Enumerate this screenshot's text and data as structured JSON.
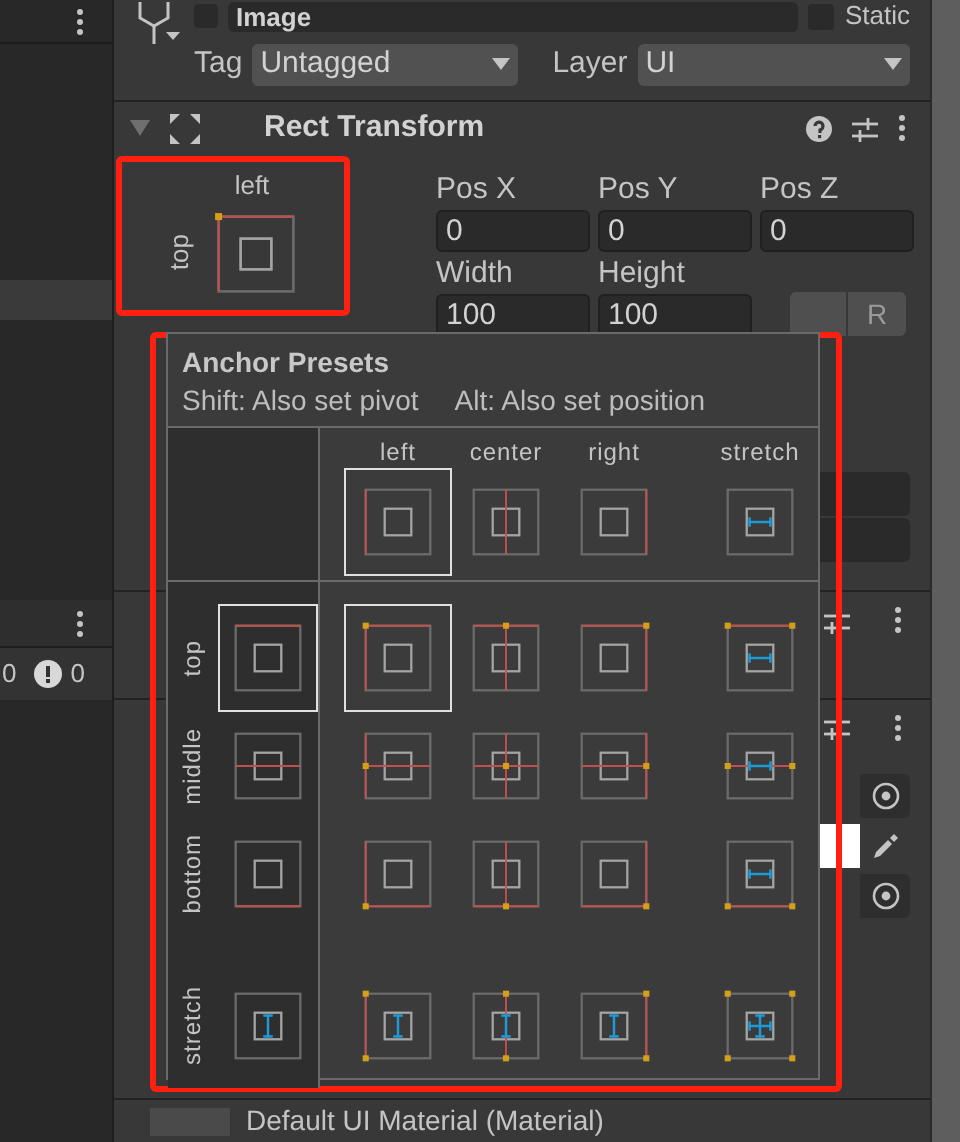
{
  "hierarchy_counts": [
    {
      "kind": "plain",
      "text": "0"
    },
    {
      "kind": "warning",
      "text": "0"
    }
  ],
  "object": {
    "name": "Image",
    "static_label": "Static",
    "static_checked": false
  },
  "tag": {
    "label": "Tag",
    "value": "Untagged"
  },
  "layer": {
    "label": "Layer",
    "value": "UI"
  },
  "rect_transform": {
    "title": "Rect Transform",
    "expanded": true,
    "anchor": {
      "h_label": "left",
      "v_label": "top"
    },
    "fields": [
      {
        "label": "Pos X",
        "value": "0"
      },
      {
        "label": "Pos Y",
        "value": "0"
      },
      {
        "label": "Pos Z",
        "value": "0"
      },
      {
        "label": "Width",
        "value": "100"
      },
      {
        "label": "Height",
        "value": "100"
      }
    ],
    "raw_button": "R"
  },
  "anchor_presets": {
    "title": "Anchor Presets",
    "hint_shift": "Shift: Also set pivot",
    "hint_alt": "Alt: Also set position",
    "columns": [
      {
        "label": "left",
        "kind": "left",
        "selected": true
      },
      {
        "label": "center",
        "kind": "center",
        "selected": false
      },
      {
        "label": "right",
        "kind": "right",
        "selected": false
      },
      {
        "label": "stretch",
        "kind": "stretch",
        "selected": false
      }
    ],
    "rows": [
      {
        "label": "top",
        "kind": "top",
        "selected": true
      },
      {
        "label": "middle",
        "kind": "middle",
        "selected": false
      },
      {
        "label": "bottom",
        "kind": "bottom",
        "selected": false
      },
      {
        "label": "stretch",
        "kind": "stretch",
        "selected": false
      }
    ]
  },
  "material": {
    "value": "Default UI Material (Material)"
  }
}
